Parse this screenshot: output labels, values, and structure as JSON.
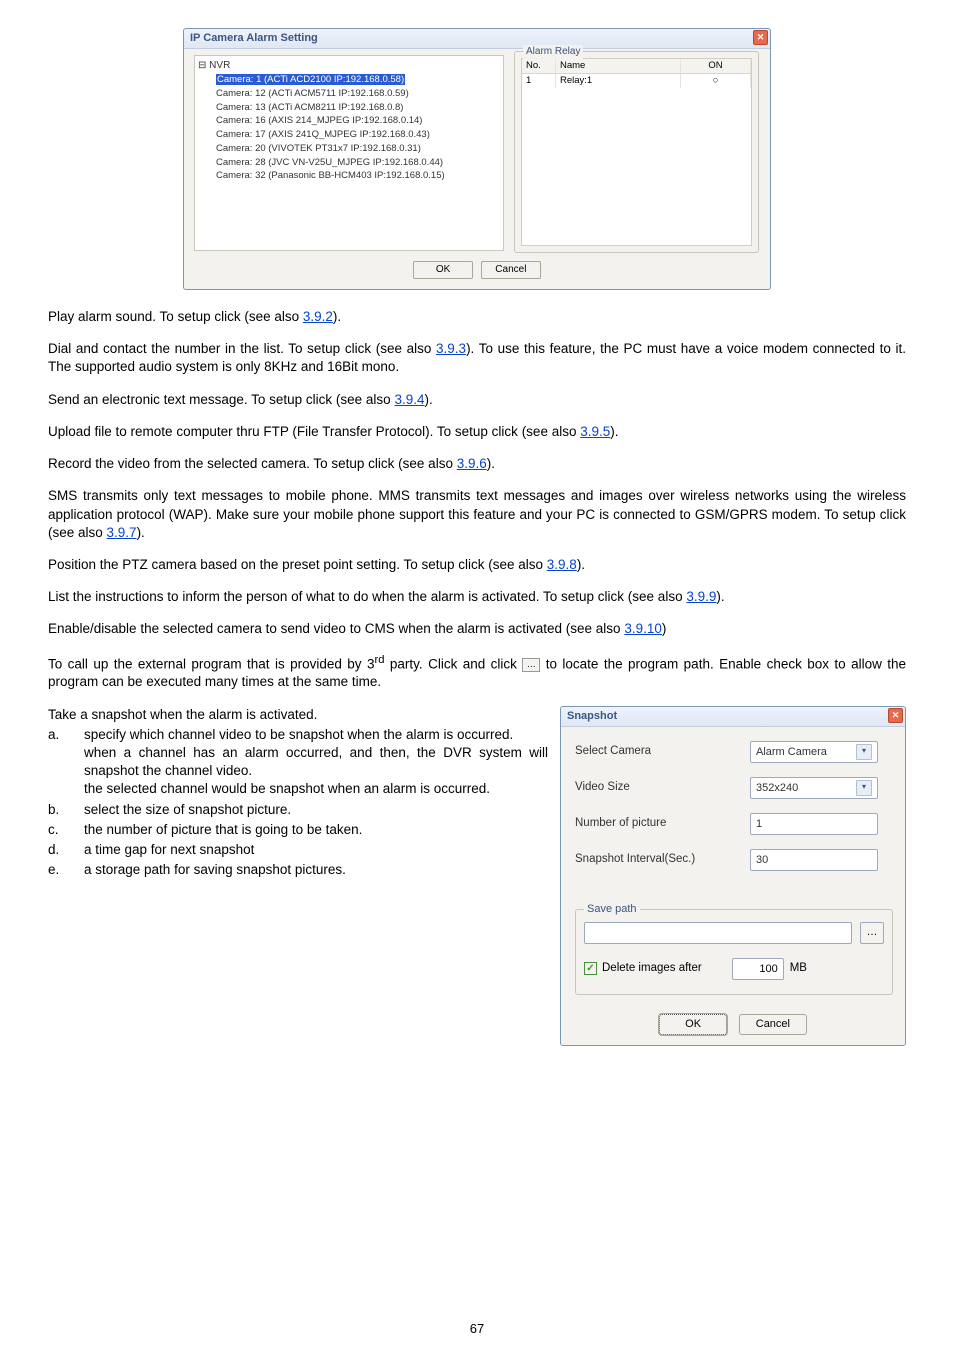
{
  "dialog1": {
    "title": "IP Camera Alarm Setting",
    "tree_root": "NVR",
    "tree_items": [
      "Camera: 1 (ACTi ACD2100 IP:192.168.0.58)",
      "Camera: 12 (ACTi ACM5711 IP:192.168.0.59)",
      "Camera: 13 (ACTi ACM8211 IP:192.168.0.8)",
      "Camera: 16 (AXIS 214_MJPEG IP:192.168.0.14)",
      "Camera: 17 (AXIS 241Q_MJPEG IP:192.168.0.43)",
      "Camera: 20 (VIVOTEK PT31x7 IP:192.168.0.31)",
      "Camera: 28 (JVC VN-V25U_MJPEG IP:192.168.0.44)",
      "Camera: 32 (Panasonic BB-HCM403 IP:192.168.0.15)"
    ],
    "right_title": "Alarm Relay",
    "th_no": "No.",
    "th_name": "Name",
    "th_on": "ON",
    "row_no": "1",
    "row_name": "Relay:1",
    "row_on": "○",
    "ok": "OK",
    "cancel": "Cancel"
  },
  "p1_a": "Play alarm sound. To setup click ",
  "p1_b": " (see also ",
  "p1_link": "3.9.2",
  "p1_c": ").",
  "p2_a": "Dial and contact the number in the list. To setup click ",
  "p2_b": " (see also ",
  "p2_link": "3.9.3",
  "p2_c": "). To use this feature, the PC must have a voice modem connected to it. The supported audio system is only 8KHz and 16Bit mono.",
  "p3_a": "Send an electronic text message. To setup click ",
  "p3_b": " (see also ",
  "p3_link": "3.9.4",
  "p3_c": ").",
  "p4_a": "Upload file to remote computer thru FTP (File Transfer Protocol). To setup click ",
  "p4_b": " (see also ",
  "p4_link": "3.9.5",
  "p4_c": ").",
  "p5_a": "Record the video from the selected camera. To setup click ",
  "p5_b": " (see also ",
  "p5_link": "3.9.6",
  "p5_c": ").",
  "p6_a": "SMS transmits only text messages to mobile phone. MMS transmits text messages and images over wireless networks using the wireless application protocol (WAP). Make sure your mobile phone support this feature and your PC is connected to GSM/GPRS modem. To setup click ",
  "p6_b": " (see also ",
  "p6_link": "3.9.7",
  "p6_c": ").",
  "p7_a": "Position the PTZ camera based on the preset point setting. To setup click ",
  "p7_b": " (see also ",
  "p7_link": "3.9.8",
  "p7_c": ").",
  "p8_a": "List the instructions to inform the person of what to do when the alarm is activated. To setup click ",
  "p8_b": " (see also ",
  "p8_link": "3.9.9",
  "p8_c": ").",
  "p9_a": "Enable/disable the selected camera to send video to CMS when the alarm is activated (see also ",
  "p9_link": "3.9.10",
  "p9_b": ")",
  "p10_a": "To call up the external program that is provided by 3",
  "p10_sup": "rd",
  "p10_b": " party. Click ",
  "p10_c": " and click ",
  "p10_d": " to locate the program path. Enable ",
  "p10_e": " check box to allow the program can be executed many times at the same time.",
  "p11": "Take a snapshot when the alarm is activated.",
  "li_a1": " specify which channel video to be snapshot when the alarm is occurred.",
  "li_a2": " when a channel has an alarm occurred, and then, the DVR system will snapshot the channel video.",
  "li_a3": " the selected channel would be snapshot when an alarm is occurred.",
  "li_b": " select the size of snapshot picture.",
  "li_c": " the number of picture that is going to be taken.",
  "li_d": " a time gap for next snapshot",
  "li_e": " a storage path for saving snapshot pictures.",
  "letters": {
    "a": "a.",
    "b": "b.",
    "c": "c.",
    "d": "d.",
    "e": "e."
  },
  "snapshot": {
    "title": "Snapshot",
    "l1": "Select Camera",
    "v1": "Alarm Camera",
    "l2": "Video Size",
    "v2": "352x240",
    "l3": "Number of picture",
    "v3": "1",
    "l4": "Snapshot Interval(Sec.)",
    "v4": "30",
    "save_path": "Save path",
    "del": "Delete images after",
    "del_val": "100",
    "del_unit": "MB",
    "ok": "OK",
    "cancel": "Cancel"
  },
  "page_num": "67"
}
